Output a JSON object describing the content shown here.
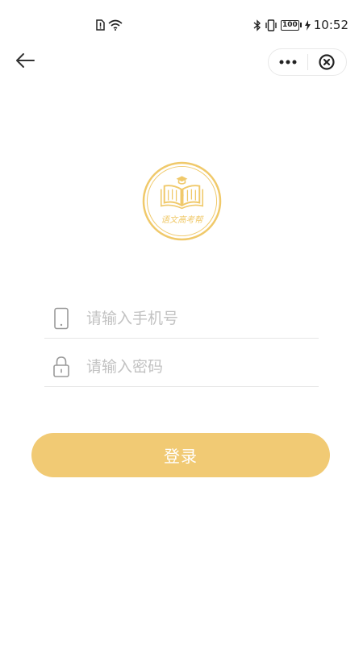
{
  "status_bar": {
    "battery_level": "100",
    "time": "10:52"
  },
  "logo": {
    "text": "语文高考帮"
  },
  "form": {
    "phone_placeholder": "请输入手机号",
    "password_placeholder": "请输入密码"
  },
  "login_label": "登录",
  "colors": {
    "accent": "#f1ca74",
    "logo_ring": "#f0c96a"
  }
}
